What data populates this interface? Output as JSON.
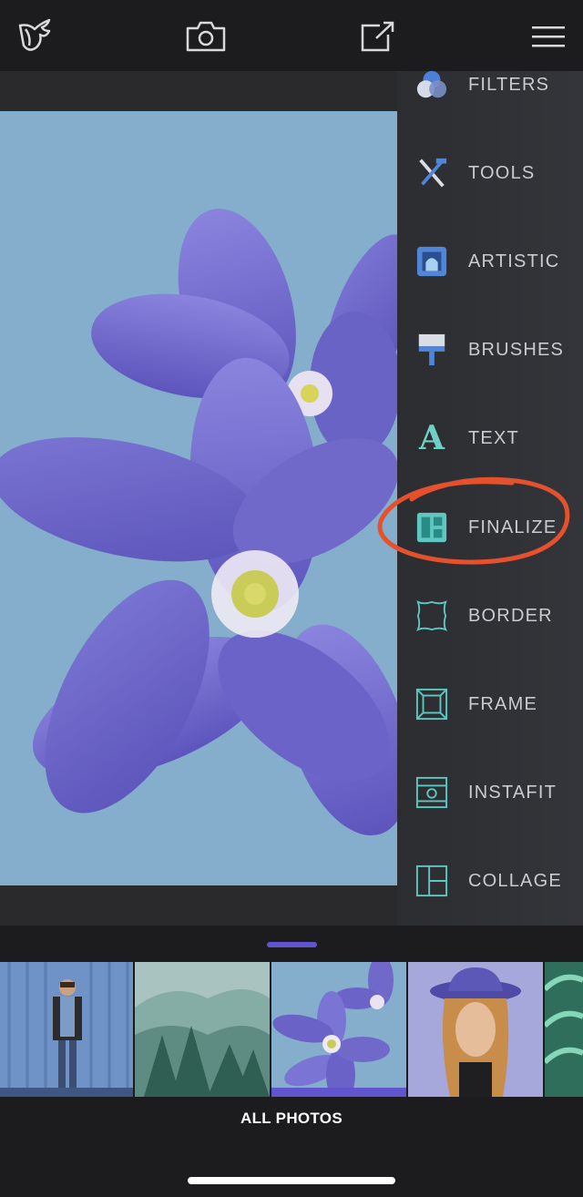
{
  "toolbar": {
    "icons": [
      "logo-icon",
      "camera-icon",
      "share-icon",
      "hamburger-menu-icon"
    ]
  },
  "menu": {
    "items": [
      {
        "label": "FILTERS",
        "icon": "filters-icon"
      },
      {
        "label": "TOOLS",
        "icon": "tools-icon"
      },
      {
        "label": "ARTISTIC",
        "icon": "artistic-icon"
      },
      {
        "label": "BRUSHES",
        "icon": "brush-icon"
      },
      {
        "label": "TEXT",
        "icon": "text-icon"
      },
      {
        "label": "FINALIZE",
        "icon": "finalize-icon"
      },
      {
        "label": "BORDER",
        "icon": "border-icon"
      },
      {
        "label": "FRAME",
        "icon": "frame-icon"
      },
      {
        "label": "INSTAFIT",
        "icon": "instafit-icon"
      },
      {
        "label": "COLLAGE",
        "icon": "collage-icon"
      }
    ]
  },
  "photos": {
    "label": "ALL PHOTOS",
    "selected_index": 2
  },
  "colors": {
    "accent": "#6155cf",
    "annotation": "#e5512c",
    "canvas_bg": "#84aecb",
    "icon_teal": "#5ec8c0"
  }
}
